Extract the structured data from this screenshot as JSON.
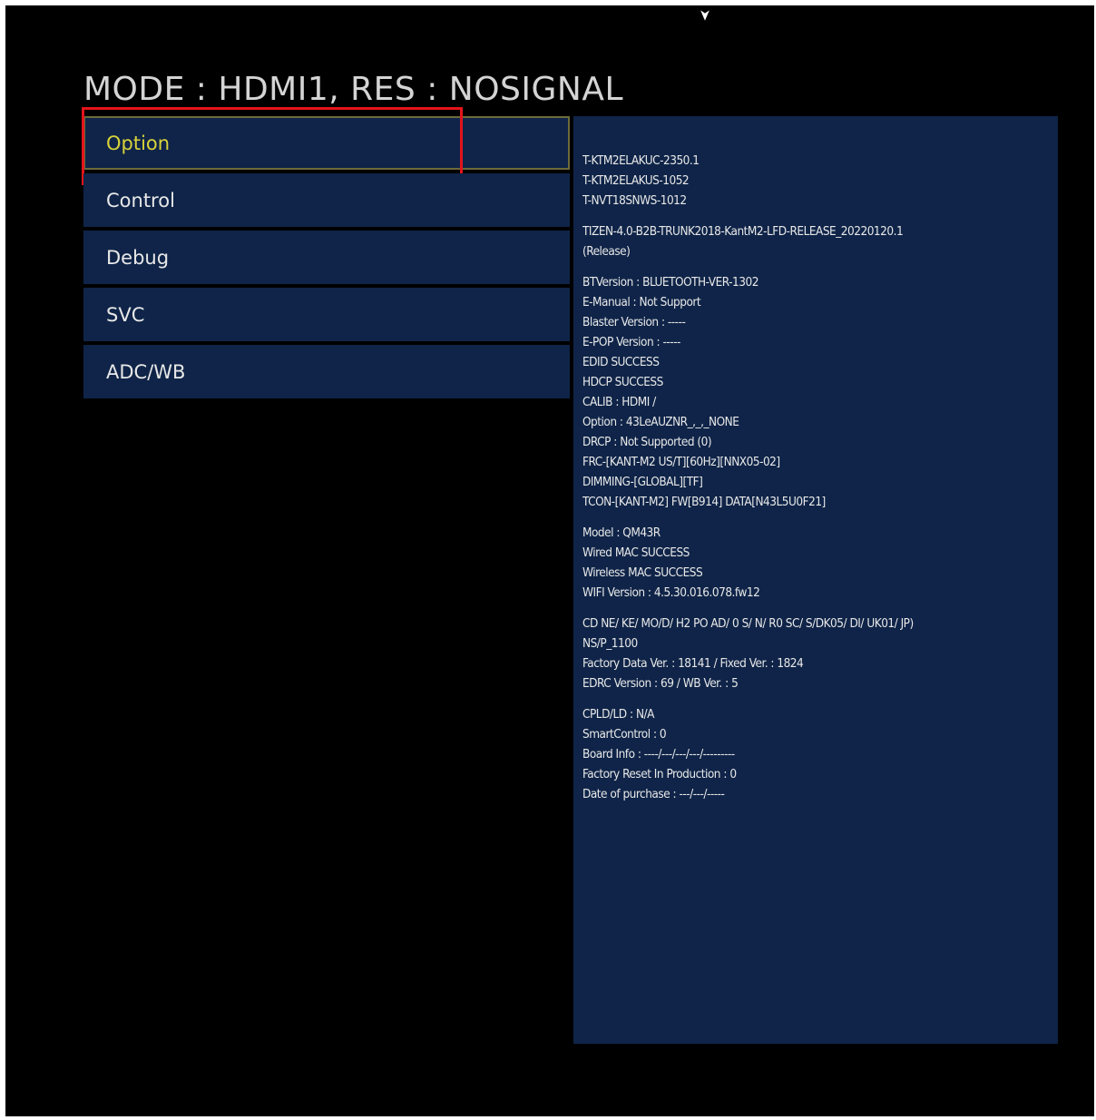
{
  "colors": {
    "screen_background": "#000000",
    "panel_background": "#0f2448",
    "header_text": "#d4d4d4",
    "menu_text": "#e8e8e8",
    "selected_text": "#d8d23a",
    "info_text": "#e8e8e8",
    "highlight_box": "#e3141b"
  },
  "header": {
    "title": "MODE : HDMI1, RES : NOSIGNAL"
  },
  "menu": {
    "items": [
      {
        "label": "Option",
        "selected": true
      },
      {
        "label": "Control",
        "selected": false
      },
      {
        "label": "Debug",
        "selected": false
      },
      {
        "label": "SVC",
        "selected": false
      },
      {
        "label": "ADC/WB",
        "selected": false
      }
    ]
  },
  "info_panel": {
    "groups": [
      {
        "lines": [
          "T-KTM2ELAKUC-2350.1",
          "T-KTM2ELAKUS-1052",
          "T-NVT18SNWS-1012"
        ]
      },
      {
        "lines": [
          "TIZEN-4.0-B2B-TRUNK2018-KantM2-LFD-RELEASE_20220120.1",
          "(Release)"
        ]
      },
      {
        "lines": [
          "BTVersion : BLUETOOTH-VER-1302",
          "E-Manual : Not Support",
          "Blaster Version : -----",
          "E-POP Version : -----",
          "EDID SUCCESS",
          "HDCP SUCCESS",
          "CALIB : HDMI /",
          "Option : 43LeAUZNR_,_,_NONE",
          "DRCP : Not Supported (0)",
          "FRC-[KANT-M2 US/T][60Hz][NNX05-02]",
          "DIMMING-[GLOBAL][TF]",
          "TCON-[KANT-M2] FW[B914] DATA[N43L5U0F21]"
        ]
      },
      {
        "lines": [
          "Model : QM43R",
          "Wired MAC SUCCESS",
          "Wireless MAC SUCCESS",
          "WIFI Version : 4.5.30.016.078.fw12"
        ]
      },
      {
        "lines": [
          "CD NE/ KE/ MO/D/ H2 PO AD/ 0 S/ N/ R0 SC/ S/DK05/ DI/ UK01/ JP)",
          "NS/P_1100",
          "Factory Data Ver. : 18141 / Fixed Ver. : 1824",
          "EDRC Version : 69 / WB Ver. : 5"
        ]
      },
      {
        "lines": [
          "CPLD/LD : N/A",
          "SmartControl : 0",
          "Board Info : ----/---/---/---/---------",
          "Factory Reset In Production : 0",
          "Date of purchase : ---/---/-----"
        ]
      }
    ]
  }
}
